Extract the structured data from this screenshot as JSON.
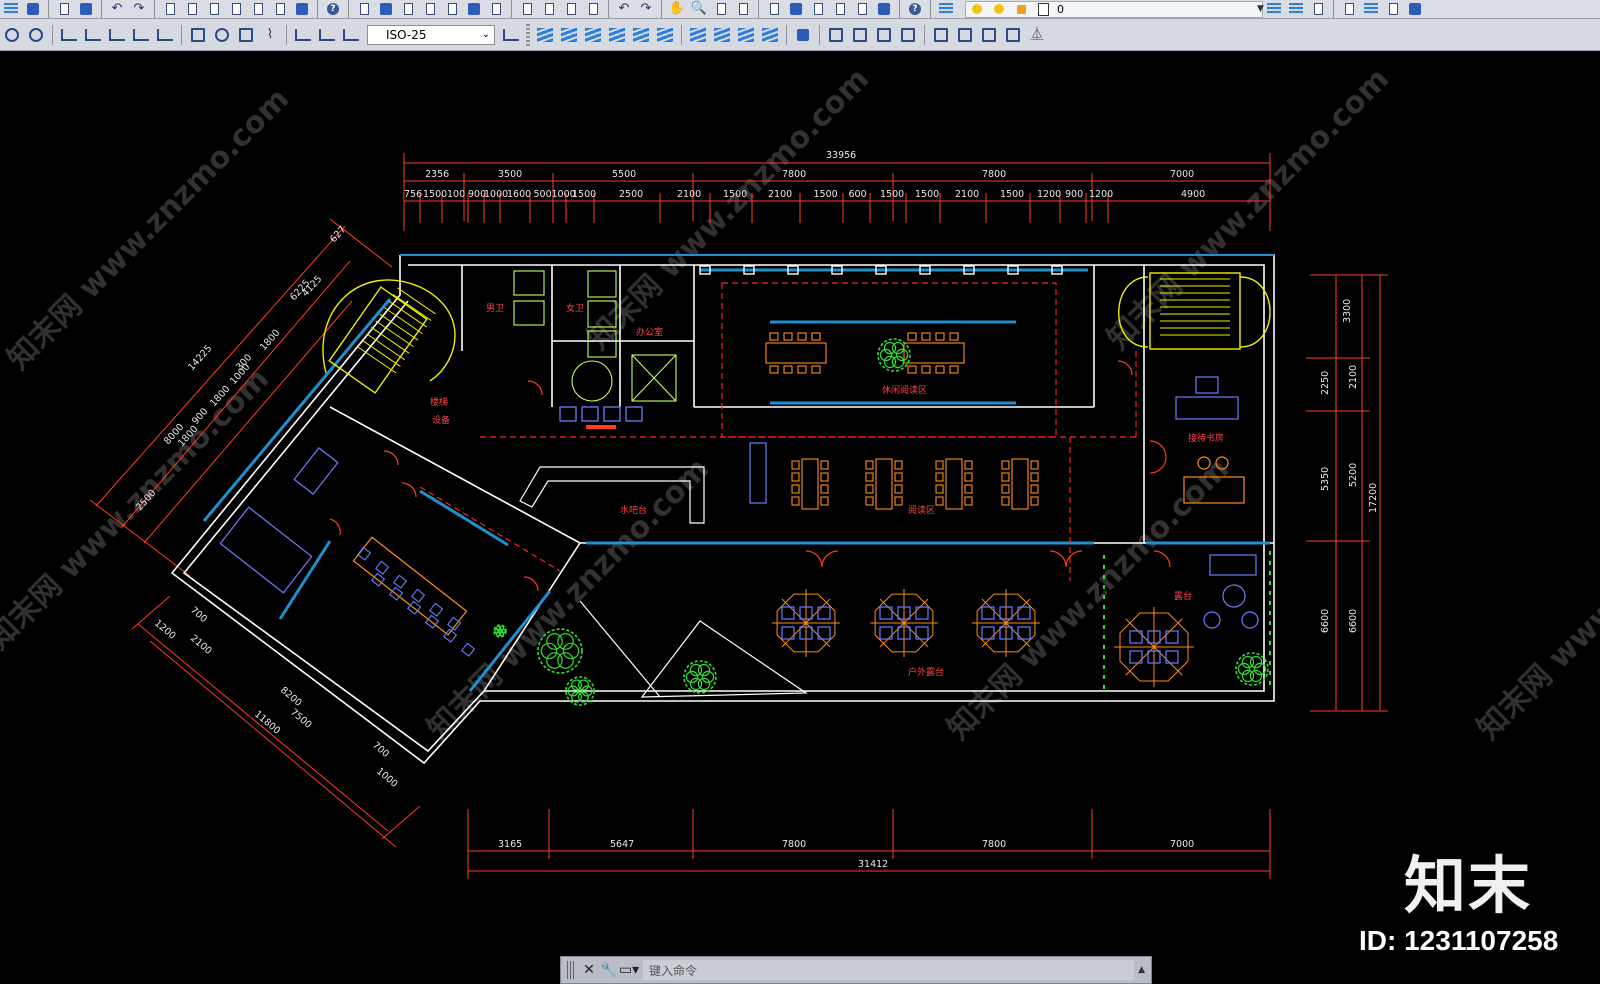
{
  "toolbar": {
    "layer_name": "0",
    "dimstyle_value": "ISO-25"
  },
  "command_line": {
    "placeholder": "键入命令",
    "close_glyph": "✕",
    "wrench_glyph": "🔧",
    "expand_glyph": "▲"
  },
  "watermark": {
    "brand": "知末",
    "id_text": "ID: 1231107258",
    "diagonal_text": "知末网 www.znzmo.com"
  },
  "drawing": {
    "top_total": "33956",
    "top_segments": [
      "2356",
      "3500",
      "5500",
      "7800",
      "7800",
      "7000"
    ],
    "top_sub": [
      "756",
      "1500",
      "100",
      "900",
      "1000",
      "1600",
      "500",
      "1000",
      "1500",
      "2500",
      "2100",
      "1500",
      "2100",
      "1500",
      "600",
      "1500",
      "1500",
      "2100",
      "1500",
      "1200",
      "900",
      "1200",
      "4900"
    ],
    "bottom_segments": [
      "3165",
      "5647",
      "7800",
      "7800",
      "7000"
    ],
    "bottom_total": "31412",
    "right_outer": [
      "3300",
      "2250",
      "5350",
      "6600"
    ],
    "right_inner": [
      "2100",
      "5200",
      "6600"
    ],
    "right_total": "17200",
    "left_diag_outer": [
      "627",
      "6225",
      "14225"
    ],
    "left_diag_mid": [
      "4125",
      "1800",
      "300",
      "1000",
      "1800",
      "900",
      "1800",
      "8000",
      "2500"
    ],
    "bottom_left_dims": [
      "1200",
      "700",
      "2100",
      "8200",
      "11800",
      "7500",
      "700",
      "1000"
    ],
    "rooms": {
      "leisure_reading": "休闲阅读区",
      "reading_area": "阅读区",
      "water_bar": "水吧台",
      "reception": "接待书房",
      "outdoor_deck": "户外露台",
      "terrace": "露台",
      "male_wc": "男卫",
      "female_wc": "女卫",
      "office": "办公室",
      "staircase_label": "楼梯",
      "equip": "设备"
    }
  },
  "colors": {
    "dimension": "#ff3b1f",
    "wall": "#ffffff",
    "glass": "#1e90d0",
    "furniture": "#ff8c1a",
    "stair": "#f0f000",
    "zone_line": "#ff2020",
    "plant": "#33dd33",
    "furniture_blue": "#6b7cff"
  }
}
